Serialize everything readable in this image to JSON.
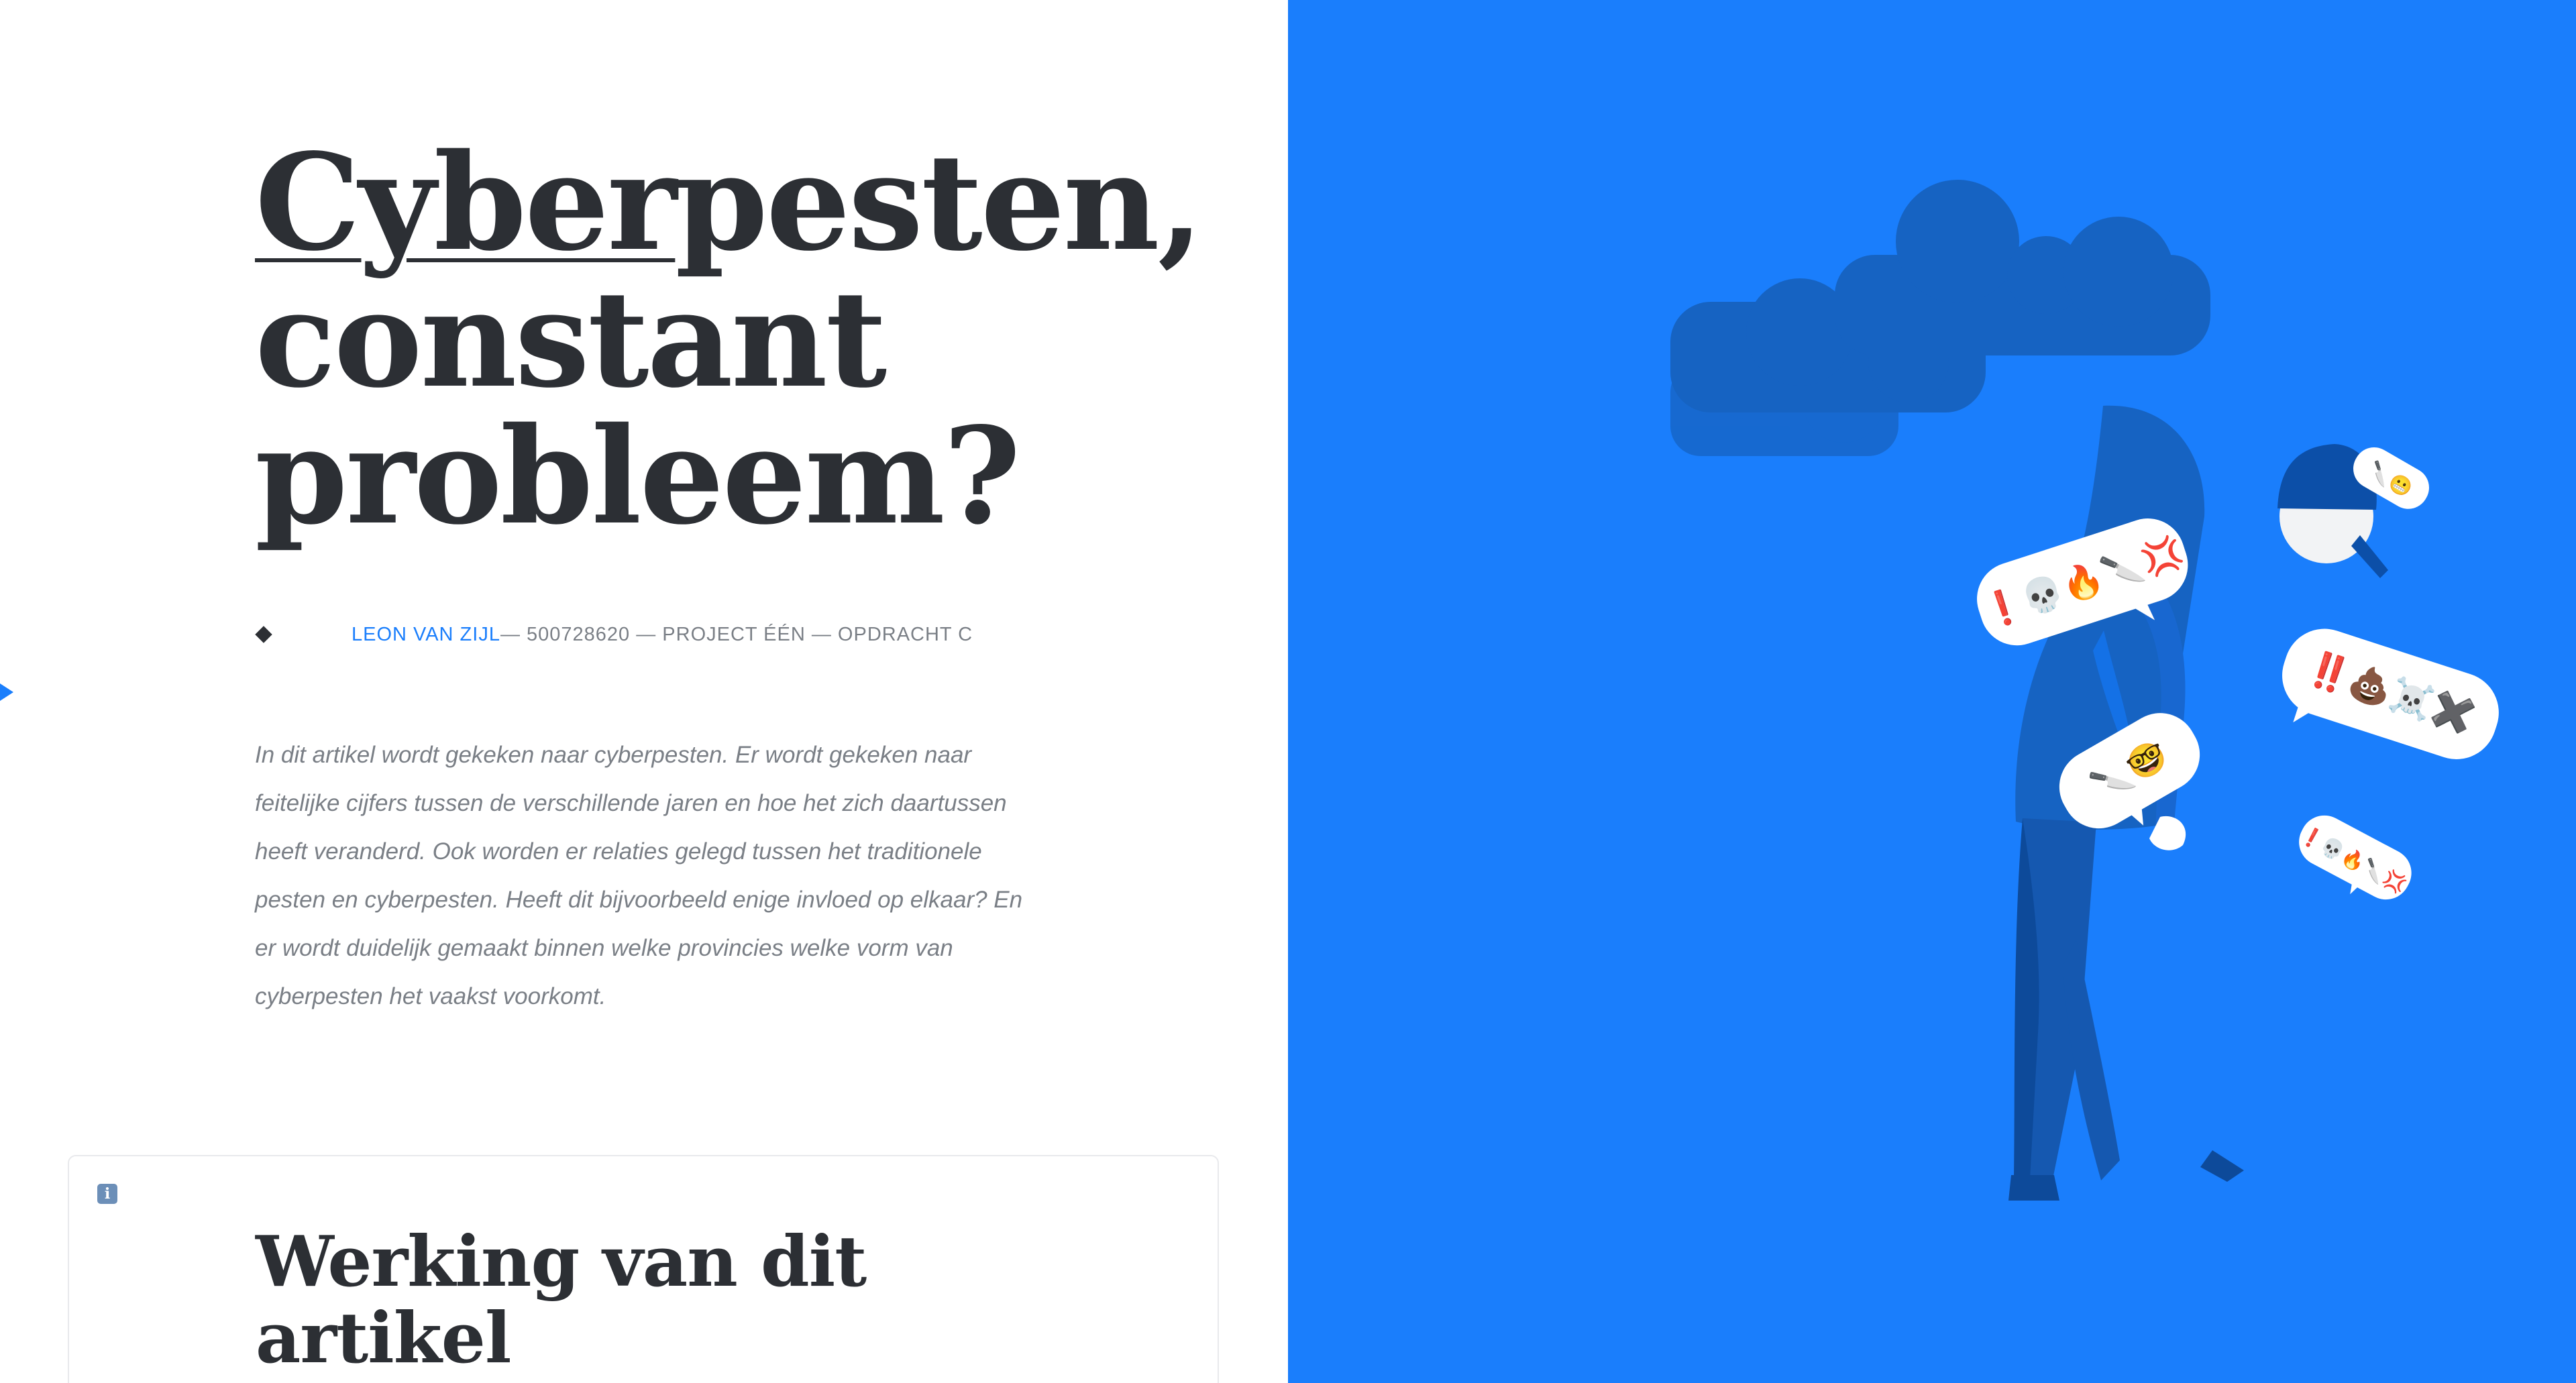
{
  "article": {
    "title_line1_underlined": "Cyber",
    "title_line1_rest": "pesten,",
    "title_line2": "constant",
    "title_line3": "probleem?",
    "byline": {
      "author": "LEON VAN ZIJL",
      "rest": " — 500728620 — PROJECT ÉÉN — OPDRACHT C"
    },
    "intro": "In dit artikel wordt gekeken naar cyberpesten. Er wordt gekeken naar feitelijke cijfers tussen de verschillende jaren en hoe het zich daartussen heeft veranderd. Ook worden er relaties gelegd tussen het traditionele pesten en cyberpesten. Heeft dit bijvoorbeeld enige invloed op elkaar? En er wordt duidelijk gemaakt binnen welke provincies welke vorm van cyberpesten het vaakst voorkomt."
  },
  "info_card": {
    "icon_label": "i",
    "title": "Werking van dit artikel"
  },
  "illustration": {
    "bubble_1": "❗💀🔥🔪💢",
    "bubble_2": "🔪🤓",
    "bubble_3": "‼️💩☠️✖️",
    "bubble_4": "❗💀🔥🔪💢",
    "bubble_5": "🔪😬"
  },
  "colors": {
    "accent": "#1a7efc",
    "text_dark": "#2c2f34",
    "text_muted": "#7a7f86",
    "cloud": "#1663c2",
    "figure_dark": "#1558b0",
    "cap": "#0c4fa8"
  },
  "icons": {
    "info": "info-icon",
    "marker": "diamond-icon"
  }
}
